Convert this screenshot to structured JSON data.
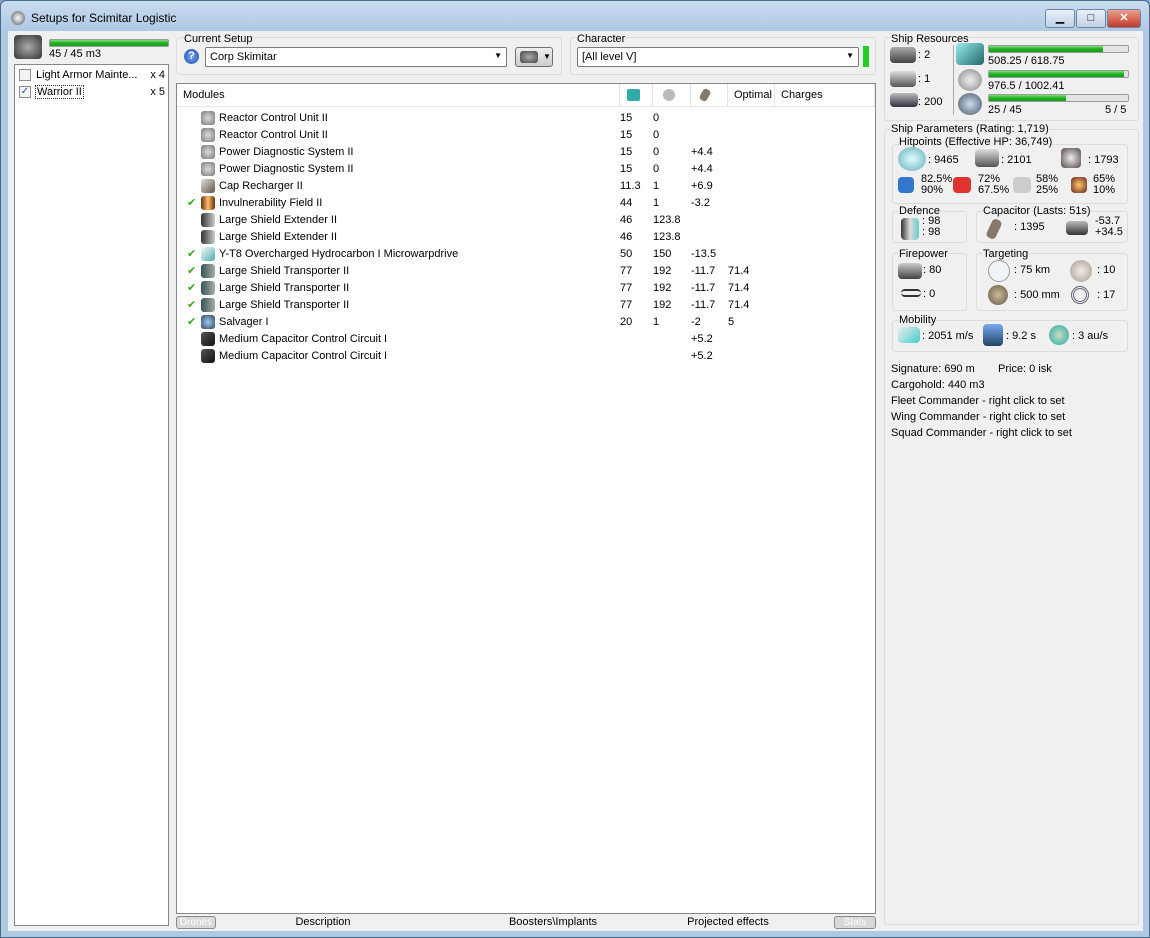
{
  "window": {
    "title": "Setups for Scimitar Logistic",
    "minimize": "▁",
    "maximize": "□",
    "close": "✕"
  },
  "drones": {
    "bay": "45 / 45 m3",
    "bay_fraction": 1.0,
    "items": [
      {
        "name": "Light Armor Mainte...",
        "count": "x 4",
        "checked": false
      },
      {
        "name": "Warrior II",
        "count": "x 5",
        "checked": true
      }
    ]
  },
  "setup": {
    "label": "Current Setup",
    "value": "Corp Skimitar",
    "help": "?"
  },
  "character": {
    "label": "Character",
    "value": "[All level V]"
  },
  "modules": {
    "headers": {
      "name": "Modules",
      "cpu_icon": "cpu-icon",
      "pg_icon": "powergrid-icon",
      "cap_icon": "capacitor-icon",
      "optimal": "Optimal",
      "charges": "Charges"
    },
    "rows": [
      {
        "active": false,
        "icon": "powergrid-icon",
        "name": "Reactor Control Unit II",
        "cpu": "15",
        "pg": "0",
        "cap": "",
        "optimal": "",
        "charges": ""
      },
      {
        "active": false,
        "icon": "powergrid-icon",
        "name": "Reactor Control Unit II",
        "cpu": "15",
        "pg": "0",
        "cap": "",
        "optimal": "",
        "charges": ""
      },
      {
        "active": false,
        "icon": "powergrid-icon",
        "name": "Power Diagnostic System II",
        "cpu": "15",
        "pg": "0",
        "cap": "+4.4",
        "optimal": "",
        "charges": ""
      },
      {
        "active": false,
        "icon": "powergrid-icon",
        "name": "Power Diagnostic System II",
        "cpu": "15",
        "pg": "0",
        "cap": "+4.4",
        "optimal": "",
        "charges": ""
      },
      {
        "active": false,
        "icon": "cap-recharger-icon",
        "name": "Cap Recharger II",
        "cpu": "11.3",
        "pg": "1",
        "cap": "+6.9",
        "optimal": "",
        "charges": ""
      },
      {
        "active": true,
        "icon": "invulnerability-field-icon",
        "name": "Invulnerability Field II",
        "cpu": "44",
        "pg": "1",
        "cap": "-3.2",
        "optimal": "",
        "charges": ""
      },
      {
        "active": false,
        "icon": "shield-extender-icon",
        "name": "Large Shield Extender II",
        "cpu": "46",
        "pg": "123.8",
        "cap": "",
        "optimal": "",
        "charges": ""
      },
      {
        "active": false,
        "icon": "shield-extender-icon",
        "name": "Large Shield Extender II",
        "cpu": "46",
        "pg": "123.8",
        "cap": "",
        "optimal": "",
        "charges": ""
      },
      {
        "active": true,
        "icon": "microwarpdrive-icon",
        "name": "Y-T8 Overcharged Hydrocarbon I Microwarpdrive",
        "cpu": "50",
        "pg": "150",
        "cap": "-13.5",
        "optimal": "",
        "charges": ""
      },
      {
        "active": true,
        "icon": "shield-transporter-icon",
        "name": "Large Shield Transporter II",
        "cpu": "77",
        "pg": "192",
        "cap": "-11.7",
        "optimal": "71.4",
        "charges": ""
      },
      {
        "active": true,
        "icon": "shield-transporter-icon",
        "name": "Large Shield Transporter II",
        "cpu": "77",
        "pg": "192",
        "cap": "-11.7",
        "optimal": "71.4",
        "charges": ""
      },
      {
        "active": true,
        "icon": "shield-transporter-icon",
        "name": "Large Shield Transporter II",
        "cpu": "77",
        "pg": "192",
        "cap": "-11.7",
        "optimal": "71.4",
        "charges": ""
      },
      {
        "active": true,
        "icon": "salvager-icon",
        "name": "Salvager I",
        "cpu": "20",
        "pg": "1",
        "cap": "-2",
        "optimal": "5",
        "charges": ""
      },
      {
        "active": false,
        "icon": "rig-icon",
        "name": "Medium Capacitor Control Circuit I",
        "cpu": "",
        "pg": "",
        "cap": "+5.2",
        "optimal": "",
        "charges": ""
      },
      {
        "active": false,
        "icon": "rig-icon",
        "name": "Medium Capacitor Control Circuit I",
        "cpu": "",
        "pg": "",
        "cap": "+5.2",
        "optimal": "",
        "charges": ""
      }
    ]
  },
  "tabs": {
    "drones": "Drones",
    "description": "Description",
    "boosters": "Boosters\\Implants",
    "projected": "Projected effects",
    "stats": "Stats"
  },
  "resources": {
    "label": "Ship Resources",
    "turrets": ": 2",
    "launchers": ": 1",
    "calibration": ": 200",
    "cpu": "508.25 / 618.75",
    "cpu_fraction": 0.821,
    "pg": "976.5 / 1002.41",
    "pg_fraction": 0.974,
    "drone_bw": "25 / 45",
    "drone_fraction": 0.556,
    "drones_active": "5 / 5"
  },
  "params": {
    "label": "Ship Parameters (Rating: 1,719)",
    "hp_label": "Hitpoints (Effective HP: 36,749)",
    "shield": ": 9465",
    "armor": ": 2101",
    "structure": ": 1793",
    "em": [
      "82.5%",
      "90%"
    ],
    "thermal": [
      "72%",
      "67.5%"
    ],
    "kinetic": [
      "58%",
      "25%"
    ],
    "explosive": [
      "65%",
      "10%"
    ],
    "defence_label": "Defence",
    "defence": [
      ": 98",
      ": 98"
    ],
    "cap_label": "Capacitor (Lasts: 51s)",
    "cap_amount": ": 1395",
    "cap_delta": [
      "-53.7",
      "+34.5"
    ],
    "fire_label": "Firepower",
    "dps": ": 80",
    "volley": ": 0",
    "target_label": "Targeting",
    "range": ": 75 km",
    "max_targets": ": 10",
    "scan_res": ": 500 mm",
    "sensor": ": 17",
    "mob_label": "Mobility",
    "speed": ": 2051 m/s",
    "align": ": 9.2 s",
    "warp": ": 3 au/s"
  },
  "info": [
    "Signature: 690 m",
    "Price: 0 isk",
    "Cargohold: 440 m3",
    "Fleet Commander - right click to set",
    "Wing Commander - right click to set",
    "Squad Commander - right click to set"
  ],
  "colors": {
    "bar_fill": "#20b020",
    "check": "#3aa820"
  }
}
